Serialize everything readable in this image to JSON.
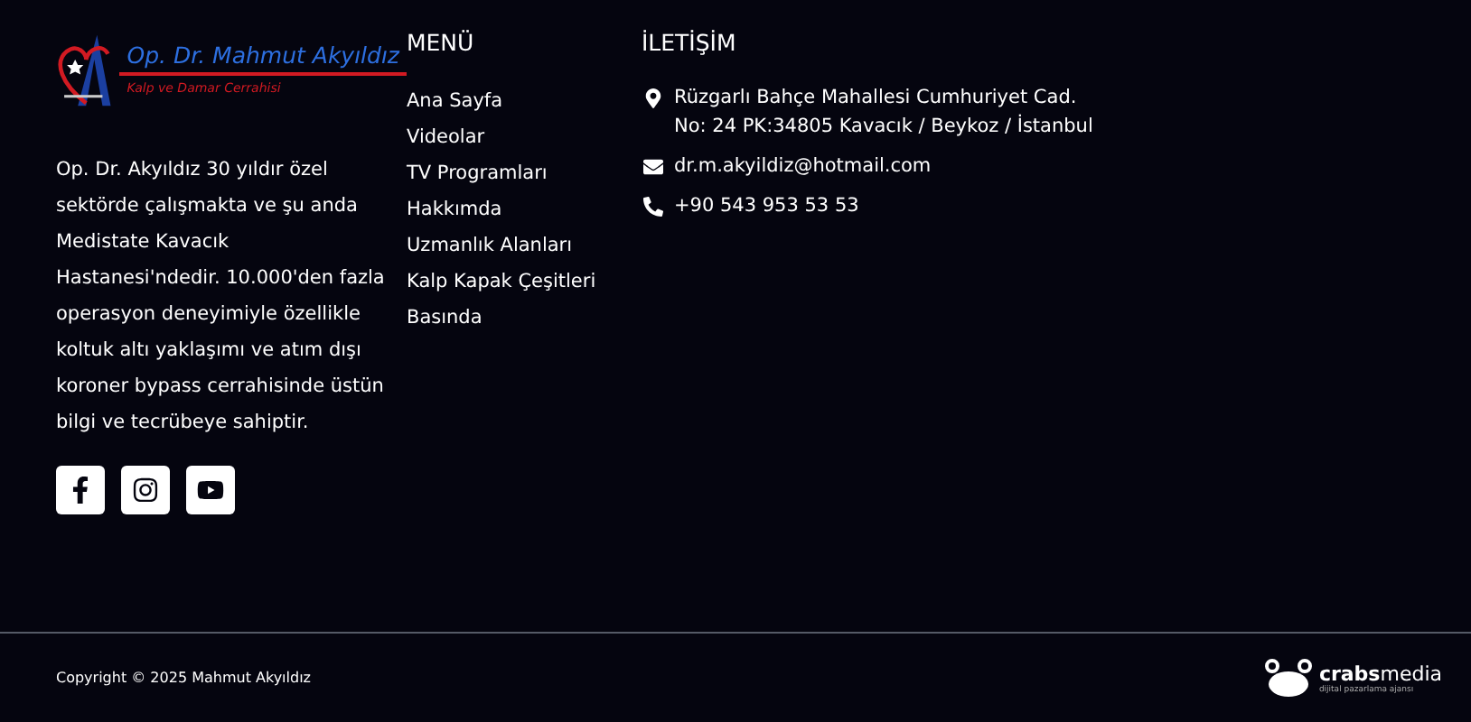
{
  "logo": {
    "name": "Op. Dr. Mahmut Akyıldız",
    "subtitle": "Kalp ve Damar Cerrahisi"
  },
  "about": "Op. Dr. Akyıldız 30 yıldır özel sektörde çalışmakta ve şu anda Medistate Kavacık Hastanesi'ndedir. 10.000'den fazla operasyon deneyimiyle özellikle koltuk altı yaklaşımı ve atım dışı koroner bypass cerrahisinde üstün bilgi ve tecrübeye sahiptir.",
  "social": [
    {
      "kind": "facebook"
    },
    {
      "kind": "instagram"
    },
    {
      "kind": "youtube"
    }
  ],
  "menu": {
    "title": "MENÜ",
    "items": [
      "Ana Sayfa",
      "Videolar",
      "TV Programları",
      "Hakkımda",
      "Uzmanlık Alanları",
      "Kalp Kapak Çeşitleri",
      "Basında"
    ]
  },
  "contact": {
    "title": "İLETİŞİM",
    "items": [
      {
        "kind": "address",
        "lines": [
          "Rüzgarlı Bahçe Mahallesi Cumhuriyet Cad.",
          "No: 24 PK:34805 Kavacık / Beykoz / İstanbul"
        ]
      },
      {
        "kind": "email",
        "lines": [
          "dr.m.akyildiz@hotmail.com"
        ]
      },
      {
        "kind": "phone",
        "lines": [
          "+90 543 953 53 53"
        ]
      }
    ]
  },
  "copyright": "Copyright © 2025 Mahmut Akyıldız",
  "agency": {
    "name_bold": "crabs",
    "name_light": "media",
    "tagline": "dijital pazarlama ajansı"
  }
}
